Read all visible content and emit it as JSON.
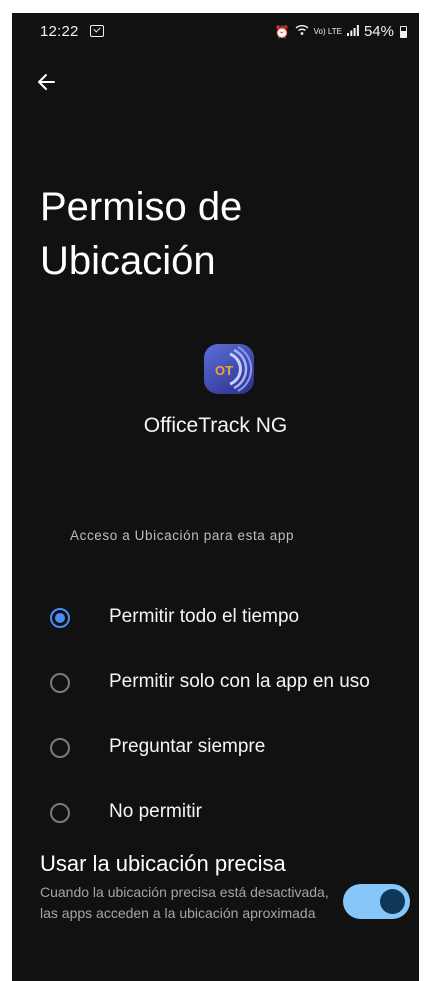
{
  "status_bar": {
    "time": "12:22",
    "battery": "54%",
    "network": "Vo) LTE"
  },
  "title": "Permiso de Ubicación",
  "app": {
    "name": "OfficeTrack NG",
    "icon_text": "OT"
  },
  "section_label": "Acceso a Ubicación para esta app",
  "options": [
    {
      "label": "Permitir todo el tiempo",
      "selected": true
    },
    {
      "label": "Permitir solo con la app en uso",
      "selected": false
    },
    {
      "label": "Preguntar siempre",
      "selected": false
    },
    {
      "label": "No permitir",
      "selected": false
    }
  ],
  "precise_location": {
    "title": "Usar la ubicación precisa",
    "description": "Cuando la ubicación precisa está desactivada, las apps acceden a la ubicación aproximada",
    "enabled": true
  },
  "colors": {
    "background": "#111111",
    "accent": "#4b8bf5",
    "toggle_track": "#86c6f8",
    "toggle_thumb": "#0f3858"
  }
}
